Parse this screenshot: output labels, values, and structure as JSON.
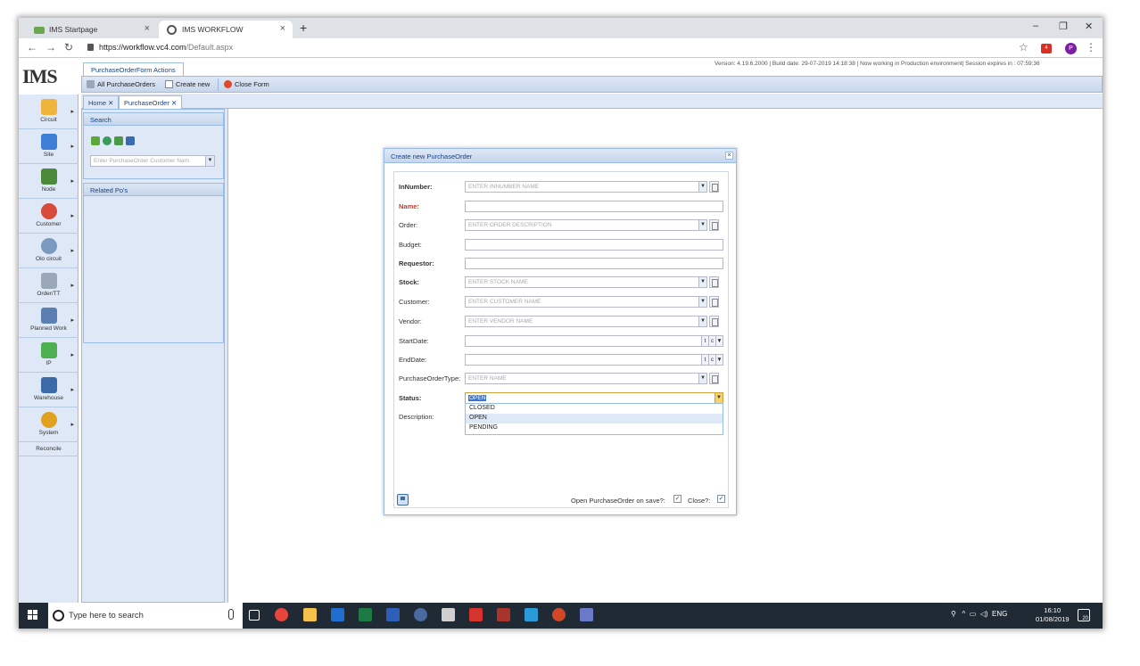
{
  "browser": {
    "tabs": [
      {
        "label": "IMS Startpage"
      },
      {
        "label": "IMS WORKFLOW"
      }
    ],
    "url_host": "https://workflow.vc4.com",
    "url_path": "/Default.aspx",
    "profile_initial": "P",
    "extension_badge": "4"
  },
  "app": {
    "logo": "IMS",
    "version_line": "Version: 4.19.6.2000 | Build date: 29-07-2019 14:18:38 | Now working in Production environment| Session expires in : 07:59:36",
    "actions_tab": "PurchaseOrderForm Actions",
    "toolbar": {
      "all_label": "All PurchaseOrders",
      "create_label": "Create new",
      "close_label": "Close Form"
    },
    "sidebar": [
      {
        "label": "Circuit",
        "icon": "circuit-icon",
        "color": "#f0b43c"
      },
      {
        "label": "Site",
        "icon": "site-icon",
        "color": "#3d7fd6"
      },
      {
        "label": "Node",
        "icon": "node-icon",
        "color": "#4a8a3a"
      },
      {
        "label": "Customer",
        "icon": "customer-icon",
        "color": "#d84a3a"
      },
      {
        "label": "Olo circuit",
        "icon": "olo-circuit-icon",
        "color": "#7a9ac0"
      },
      {
        "label": "Order/TT",
        "icon": "order-icon",
        "color": "#9aa8b8"
      },
      {
        "label": "Planned Work",
        "icon": "planned-work-icon",
        "color": "#5a7fb0"
      },
      {
        "label": "IP",
        "icon": "ip-icon",
        "color": "#4caf50"
      },
      {
        "label": "Warehouse",
        "icon": "warehouse-icon",
        "color": "#3a6aa8"
      },
      {
        "label": "System",
        "icon": "system-icon",
        "color": "#e0a020"
      }
    ],
    "sidebar_reconcile": "Reconcile",
    "page_tabs": {
      "home": "Home",
      "purchase": "PurchaseOrder"
    },
    "search_panel": {
      "title": "Search",
      "placeholder": "Enter PurchaseOrder Customer Nam"
    },
    "related_panel": {
      "title": "Related Po's"
    }
  },
  "dialog": {
    "title": "Create new PurchaseOrder",
    "fields": {
      "innumber": {
        "label": "InNumber:",
        "placeholder": "ENTER INNUMBER NAME"
      },
      "name": {
        "label": "Name:",
        "value": ""
      },
      "order": {
        "label": "Order:",
        "placeholder": "ENTER ORDER DESCRIPTION"
      },
      "budget": {
        "label": "Budget:",
        "value": ""
      },
      "requestor": {
        "label": "Requestor:",
        "value": ""
      },
      "stock": {
        "label": "Stock:",
        "placeholder": "ENTER STOCK NAME"
      },
      "customer": {
        "label": "Customer:",
        "placeholder": "ENTER CUSTOMER NAME"
      },
      "vendor": {
        "label": "Vendor:",
        "placeholder": "ENTER VENDOR NAME"
      },
      "startdate": {
        "label": "StartDate:",
        "value": ""
      },
      "enddate": {
        "label": "EndDate:",
        "value": ""
      },
      "potype": {
        "label": "PurchaseOrderType:",
        "placeholder": "ENTER  NAME"
      },
      "status": {
        "label": "Status:",
        "value": "OPEN"
      },
      "description": {
        "label": "Description:"
      }
    },
    "status_options": [
      "CLOSED",
      "OPEN",
      "PENDING"
    ],
    "status_highlighted": "OPEN",
    "open_on_save_label": "Open PurchaseOrder on save?:",
    "open_on_save_checked": true,
    "close_label": "Close?:",
    "close_checked": true,
    "date_btn_t": "t",
    "date_btn_c": "c"
  },
  "taskbar": {
    "search_placeholder": "Type here to search",
    "tray_text": "ENG",
    "time": "16:10",
    "date": "01/08/2019",
    "notification_count": "20"
  }
}
